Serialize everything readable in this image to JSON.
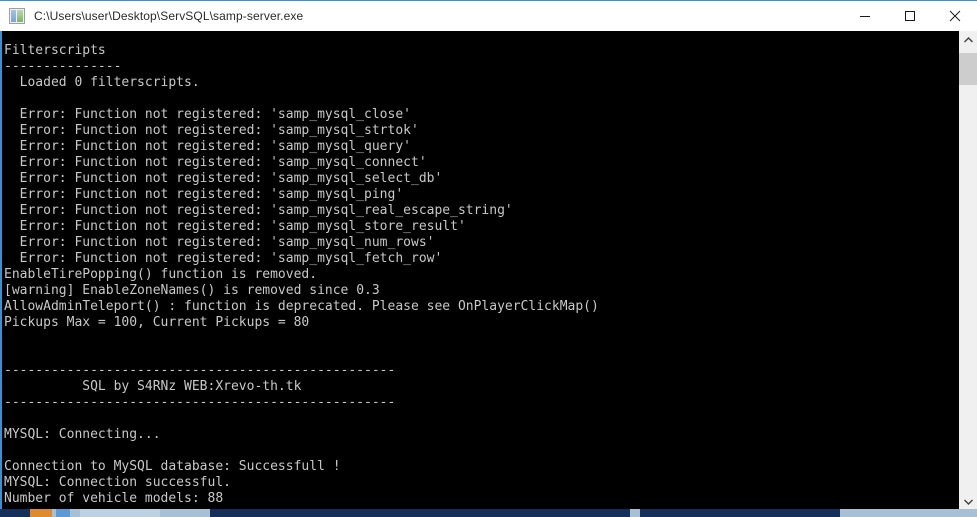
{
  "window": {
    "title": "C:\\Users\\user\\Desktop\\ServSQL\\samp-server.exe",
    "icon": "console-app-icon",
    "accent_color": "#3b8fd4",
    "titlebar_bg": "#ffffff",
    "console_bg": "#000000",
    "console_fg": "#c8c8c8"
  },
  "controls": {
    "minimize_label": "Minimize",
    "maximize_label": "Maximize",
    "close_label": "Close"
  },
  "scrollbar": {
    "up_arrow": "▲",
    "down_arrow": "▼",
    "orientation": "vertical"
  },
  "console": {
    "lines": [
      "Filterscripts",
      "---------------",
      "  Loaded 0 filterscripts.",
      "",
      "  Error: Function not registered: 'samp_mysql_close'",
      "  Error: Function not registered: 'samp_mysql_strtok'",
      "  Error: Function not registered: 'samp_mysql_query'",
      "  Error: Function not registered: 'samp_mysql_connect'",
      "  Error: Function not registered: 'samp_mysql_select_db'",
      "  Error: Function not registered: 'samp_mysql_ping'",
      "  Error: Function not registered: 'samp_mysql_real_escape_string'",
      "  Error: Function not registered: 'samp_mysql_store_result'",
      "  Error: Function not registered: 'samp_mysql_num_rows'",
      "  Error: Function not registered: 'samp_mysql_fetch_row'",
      "EnableTirePopping() function is removed.",
      "[warning] EnableZoneNames() is removed since 0.3",
      "AllowAdminTeleport() : function is deprecated. Please see OnPlayerClickMap()",
      "Pickups Max = 100, Current Pickups = 80",
      "",
      "",
      "--------------------------------------------------",
      "          SQL by S4RNz WEB:Xrevo-th.tk",
      "--------------------------------------------------",
      "",
      "MYSQL: Connecting...",
      "",
      "Connection to MySQL database: Successfull !",
      "MYSQL: Connection successful.",
      "Number of vehicle models: 88"
    ]
  }
}
